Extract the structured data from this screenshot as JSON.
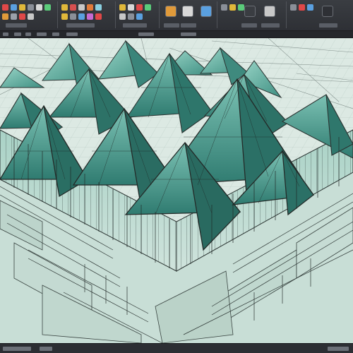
{
  "app": {
    "title": "",
    "accent": "#e0b83a",
    "glass_color": "#5aa69a",
    "frame_color": "#3a3d40",
    "paper_color": "#d9e6e0"
  },
  "ribbon": {
    "groups": [
      {
        "icons": [
          "file-icon",
          "save-icon",
          "undo-icon",
          "redo-icon",
          "print-icon",
          "settings-icon"
        ]
      },
      {
        "icons": [
          "layer-icon",
          "draw-icon",
          "line-icon",
          "move-icon",
          "copy-icon"
        ]
      },
      {
        "icons": [
          "color-icon",
          "fill-icon",
          "measure-icon",
          "grid-icon"
        ]
      },
      {
        "icons": [
          "view-icon",
          "render-icon"
        ]
      },
      {
        "icons": [
          "camera-icon",
          "light-icon",
          "material-icon"
        ]
      },
      {
        "icons": [
          "export-icon",
          "share-icon"
        ]
      }
    ]
  },
  "viewport": {
    "description_icon": "3d-model-viewport"
  }
}
